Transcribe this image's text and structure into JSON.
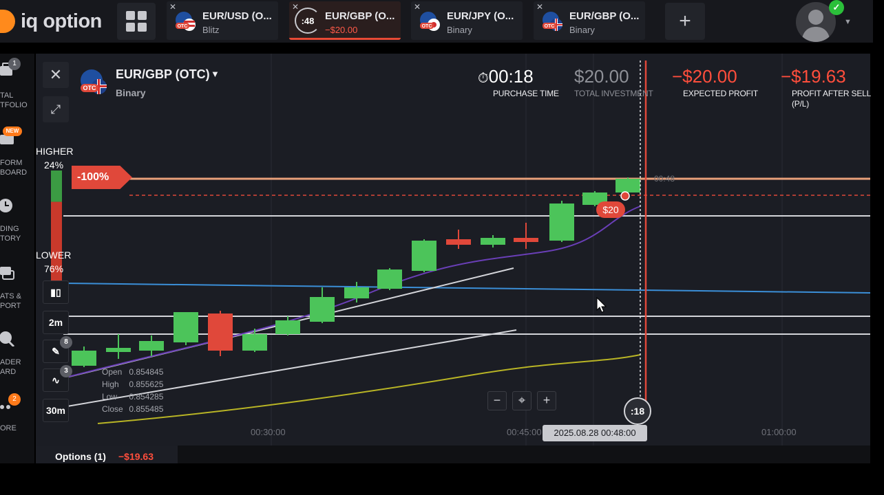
{
  "app": {
    "logo_text": "iq option"
  },
  "tabs": [
    {
      "title": "EUR/USD (O...",
      "subtitle": "Blitz",
      "flag_tag": "OTC"
    },
    {
      "title": "EUR/GBP (O...",
      "subtitle": "−$20.00",
      "timer": ":48"
    },
    {
      "title": "EUR/JPY (O...",
      "subtitle": "Binary",
      "flag_tag": "OTC"
    },
    {
      "title": "EUR/GBP (O...",
      "subtitle": "Binary",
      "flag_tag": "OTC"
    }
  ],
  "sidebar": {
    "items": [
      {
        "label": "TAL\nTFOLIO",
        "icon": "portfolio-icon",
        "badge": "1"
      },
      {
        "label": "FORM\nBOARD",
        "icon": "board-icon",
        "badge": "NEW"
      },
      {
        "label": "DING\nTORY",
        "icon": "history-icon"
      },
      {
        "label": "ATS &\nPORT",
        "icon": "chat-icon"
      },
      {
        "label": "ADER\nARD",
        "icon": "leader-icon"
      },
      {
        "label": "ORE",
        "icon": "more-icon",
        "badge": "2"
      }
    ]
  },
  "asset": {
    "name": "EUR/GBP (OTC)",
    "type": "Binary",
    "flag_tag": "OTC"
  },
  "stats": {
    "purchase_time": {
      "value": "00:18",
      "label": "PURCHASE TIME"
    },
    "total_investment": {
      "value": "$20.00",
      "label": "TOTAL INVESTMENT"
    },
    "expected_profit": {
      "value": "−$20.00",
      "label": "EXPECTED PROFIT"
    },
    "profit_after_sell": {
      "value": "−$19.63",
      "label": "PROFIT AFTER SELL\n(P/L)"
    }
  },
  "sentiment": {
    "higher_label": "HIGHER",
    "higher_pct": "24%",
    "lower_label": "LOWER",
    "lower_pct": "76%",
    "higher_share": 0.24
  },
  "position": {
    "pct_tag": "-100%",
    "marker": "$20",
    "price_label": "00:48"
  },
  "tools": {
    "timeframe": "2m",
    "expiry": "30m",
    "draw_badge": "8",
    "indicator_badge": "3"
  },
  "ohlc": {
    "open_label": "Open",
    "open": "0.854845",
    "high_label": "High",
    "high": "0.855625",
    "low_label": "Low",
    "low": "0.854285",
    "close_label": "Close",
    "close": "0.855485"
  },
  "zoom": {
    "minus": "−",
    "center": "⌖",
    "plus": "+"
  },
  "time_axis": {
    "ticks": [
      "00:30:00",
      "00:45:00",
      "01:00:00"
    ],
    "tooltip": "2025.08.28 00:48:00",
    "countdown": ":18"
  },
  "bottom": {
    "options_label": "Options (1)",
    "options_value": "−$19.63"
  },
  "colors": {
    "accent_orange": "#ff8a1c",
    "loss_red": "#ff4e3c",
    "candle_green": "#4cc45a",
    "candle_red": "#e0483a",
    "blue_line": "#3b8fd8",
    "yellow_line": "#b9b525",
    "purple_line": "#6a3fb8"
  }
}
